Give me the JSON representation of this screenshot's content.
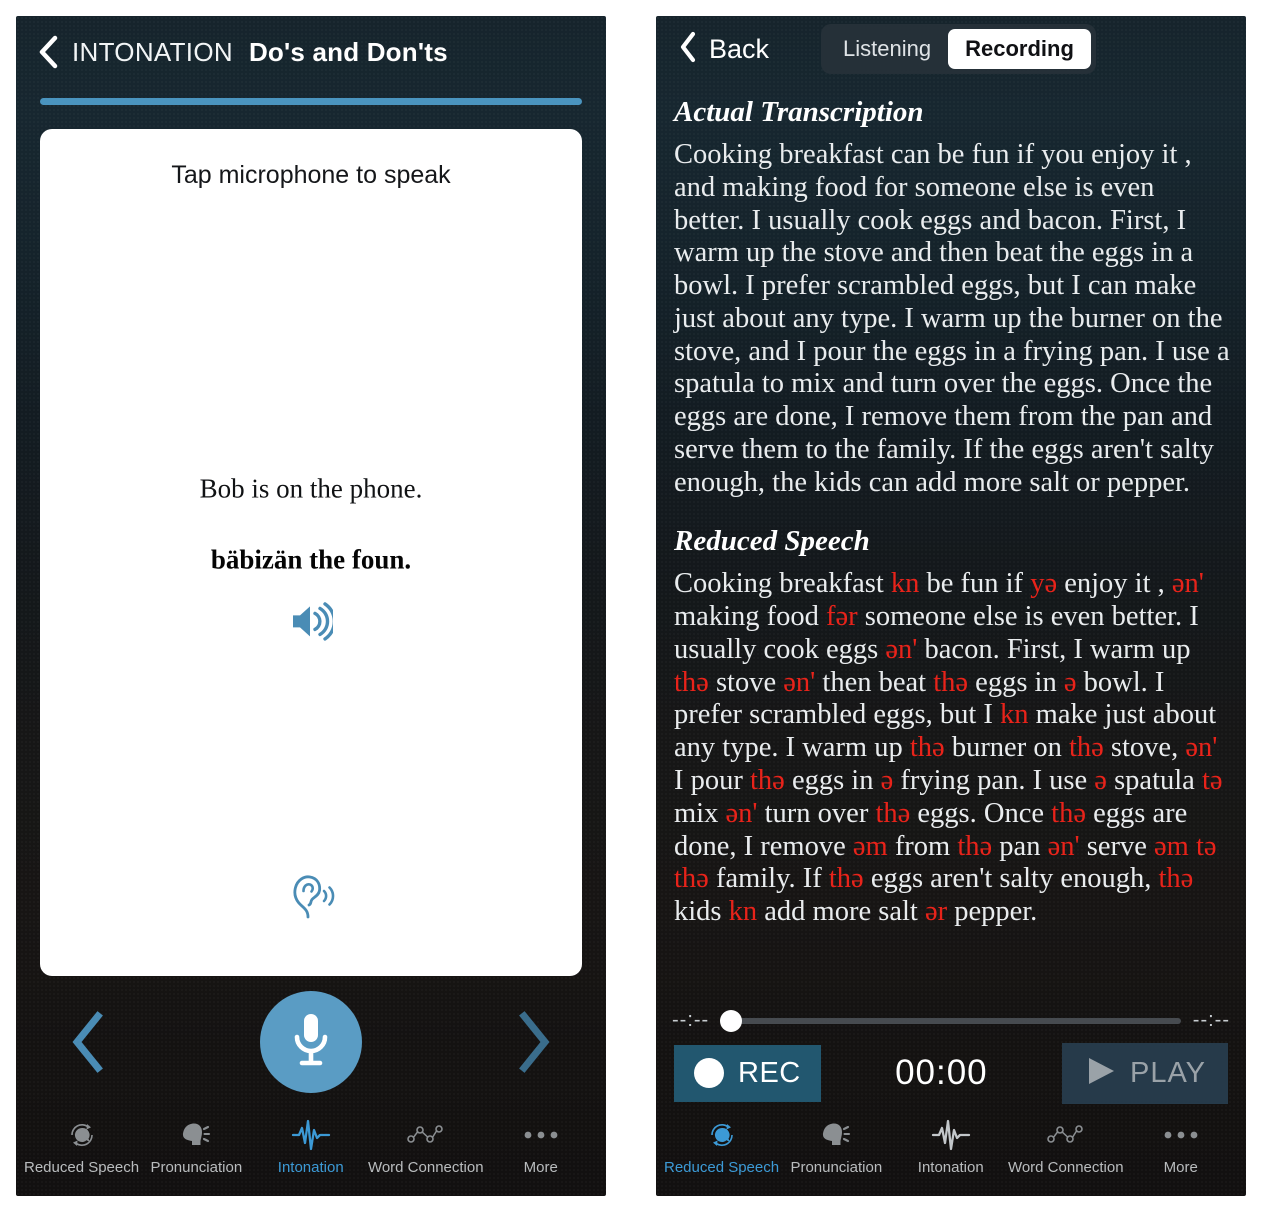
{
  "left_panel": {
    "header": {
      "back_icon": "chevron-left-icon",
      "title_category": "INTONATION",
      "title_lesson": "Do's and Don'ts"
    },
    "progress": {
      "percent": 100,
      "color": "#4a94bf"
    },
    "card": {
      "hint": "Tap microphone to speak",
      "sentence": "Bob is on the phone.",
      "phonetic": "bäbizän the foun.",
      "speaker_icon": "speaker-sound-icon",
      "ear_icon": "ear-listen-icon"
    },
    "controls": {
      "prev_icon": "chevron-left-icon",
      "next_icon": "chevron-right-icon",
      "mic_icon": "microphone-icon",
      "mic_color": "#5a9cc4"
    },
    "tabs": [
      {
        "label": "Reduced Speech",
        "icon": "reduced-speech-icon",
        "active": false
      },
      {
        "label": "Pronunciation",
        "icon": "pronunciation-icon",
        "active": false
      },
      {
        "label": "Intonation",
        "icon": "intonation-waveform-icon",
        "active": true
      },
      {
        "label": "Word Connection",
        "icon": "word-connection-icon",
        "active": false
      },
      {
        "label": "More",
        "icon": "more-dots-icon",
        "active": false
      }
    ]
  },
  "right_panel": {
    "header": {
      "back_icon": "chevron-left-icon",
      "back_label": "Back",
      "segments": [
        {
          "label": "Listening",
          "active": false
        },
        {
          "label": "Recording",
          "active": true
        }
      ]
    },
    "sections": [
      {
        "heading": "Actual Transcription",
        "parts": [
          {
            "t": "Cooking breakfast can be fun if you enjoy it , and making food for someone else is even better. I usually cook eggs and bacon. First, I warm up the stove and then beat the eggs in a bowl. I prefer scrambled eggs, but I can make just about any type. I warm up the burner on the stove, and I pour the eggs in a frying pan. I use a spatula to mix and turn over the eggs. Once the eggs are done, I remove them from the pan and serve them to the family. If the eggs aren't salty enough, the kids can add more salt or pepper.",
            "red": false
          }
        ]
      },
      {
        "heading": "Reduced Speech",
        "parts": [
          {
            "t": "Cooking breakfast ",
            "red": false
          },
          {
            "t": "kn",
            "red": true
          },
          {
            "t": " be fun if ",
            "red": false
          },
          {
            "t": "yə",
            "red": true
          },
          {
            "t": " enjoy it , ",
            "red": false
          },
          {
            "t": "ən'",
            "red": true
          },
          {
            "t": " making food ",
            "red": false
          },
          {
            "t": "fər",
            "red": true
          },
          {
            "t": " someone else is even better. I usually cook eggs ",
            "red": false
          },
          {
            "t": "ən'",
            "red": true
          },
          {
            "t": " bacon. First, I warm up ",
            "red": false
          },
          {
            "t": "thə",
            "red": true
          },
          {
            "t": " stove ",
            "red": false
          },
          {
            "t": "ən'",
            "red": true
          },
          {
            "t": " then beat ",
            "red": false
          },
          {
            "t": "thə",
            "red": true
          },
          {
            "t": " eggs in ",
            "red": false
          },
          {
            "t": "ə",
            "red": true
          },
          {
            "t": " bowl. I prefer scrambled eggs, but I ",
            "red": false
          },
          {
            "t": "kn",
            "red": true
          },
          {
            "t": " make just about any type. I warm up ",
            "red": false
          },
          {
            "t": "thə",
            "red": true
          },
          {
            "t": " burner on ",
            "red": false
          },
          {
            "t": "thə",
            "red": true
          },
          {
            "t": " stove, ",
            "red": false
          },
          {
            "t": "ən'",
            "red": true
          },
          {
            "t": " I pour ",
            "red": false
          },
          {
            "t": "thə",
            "red": true
          },
          {
            "t": " eggs in ",
            "red": false
          },
          {
            "t": "ə",
            "red": true
          },
          {
            "t": " frying pan. I use ",
            "red": false
          },
          {
            "t": "ə",
            "red": true
          },
          {
            "t": " spatula ",
            "red": false
          },
          {
            "t": "tə",
            "red": true
          },
          {
            "t": " mix ",
            "red": false
          },
          {
            "t": "ən'",
            "red": true
          },
          {
            "t": " turn over ",
            "red": false
          },
          {
            "t": "thə",
            "red": true
          },
          {
            "t": " eggs. Once ",
            "red": false
          },
          {
            "t": "thə",
            "red": true
          },
          {
            "t": " eggs are done, I remove ",
            "red": false
          },
          {
            "t": "əm",
            "red": true
          },
          {
            "t": " from ",
            "red": false
          },
          {
            "t": "thə",
            "red": true
          },
          {
            "t": " pan ",
            "red": false
          },
          {
            "t": "ən'",
            "red": true
          },
          {
            "t": " serve ",
            "red": false
          },
          {
            "t": "əm",
            "red": true
          },
          {
            "t": " ",
            "red": false
          },
          {
            "t": "tə",
            "red": true
          },
          {
            "t": " ",
            "red": false
          },
          {
            "t": "thə",
            "red": true
          },
          {
            "t": " family. If ",
            "red": false
          },
          {
            "t": "thə",
            "red": true
          },
          {
            "t": " eggs aren't salty enough, ",
            "red": false
          },
          {
            "t": "thə",
            "red": true
          },
          {
            "t": " kids ",
            "red": false
          },
          {
            "t": "kn",
            "red": true
          },
          {
            "t": " add more salt ",
            "red": false
          },
          {
            "t": "ər",
            "red": true
          },
          {
            "t": " pepper.",
            "red": false
          }
        ]
      }
    ],
    "scrubber": {
      "elapsed": "--:--",
      "remaining": "--:--",
      "position_percent": 1
    },
    "transport": {
      "rec_label": "REC",
      "rec_icon": "record-dot-icon",
      "rec_color": "#22576f",
      "timer": "00:00",
      "play_label": "PLAY",
      "play_icon": "play-triangle-icon",
      "play_color": "#263a4a",
      "play_enabled": false
    },
    "tabs": [
      {
        "label": "Reduced Speech",
        "icon": "reduced-speech-icon",
        "active": true
      },
      {
        "label": "Pronunciation",
        "icon": "pronunciation-icon",
        "active": false
      },
      {
        "label": "Intonation",
        "icon": "intonation-waveform-icon",
        "active": false
      },
      {
        "label": "Word Connection",
        "icon": "word-connection-icon",
        "active": false
      },
      {
        "label": "More",
        "icon": "more-dots-icon",
        "active": false
      }
    ]
  }
}
